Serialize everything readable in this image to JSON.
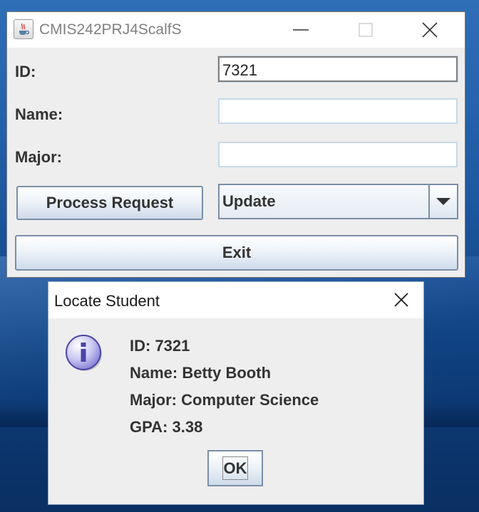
{
  "desktop": {
    "accent": "#1d57a0"
  },
  "main_window": {
    "title": "CMIS242PRJ4ScalfS",
    "icon": "java-coffee-icon",
    "controls": [
      "minimize-icon",
      "maximize-icon",
      "close-icon"
    ],
    "form": {
      "id_label": "ID:",
      "id_value": "7321",
      "name_label": "Name:",
      "name_value": "",
      "major_label": "Major:",
      "major_value": ""
    },
    "process_button": "Process Request",
    "operation_select": {
      "selected": "Update"
    },
    "exit_button": "Exit"
  },
  "dialog": {
    "title": "Locate Student",
    "icon": "info-icon",
    "lines": {
      "id": "ID: 7321",
      "name": "Name: Betty Booth",
      "major": "Major: Computer Science",
      "gpa": "GPA: 3.38"
    },
    "ok_button": "OK"
  }
}
